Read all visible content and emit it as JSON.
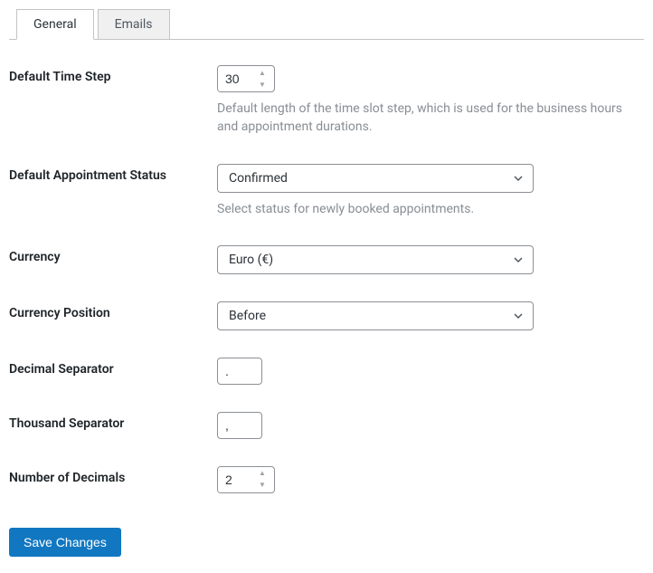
{
  "tabs": {
    "general": "General",
    "emails": "Emails"
  },
  "fields": {
    "default_time_step": {
      "label": "Default Time Step",
      "value": "30",
      "desc": "Default length of the time slot step, which is used for the business hours and appointment durations."
    },
    "default_status": {
      "label": "Default Appointment Status",
      "value": "Confirmed",
      "desc": "Select status for newly booked appointments."
    },
    "currency": {
      "label": "Currency",
      "value": "Euro (€)"
    },
    "currency_position": {
      "label": "Currency Position",
      "value": "Before"
    },
    "decimal_sep": {
      "label": "Decimal Separator",
      "value": "."
    },
    "thousand_sep": {
      "label": "Thousand Separator",
      "value": ","
    },
    "num_decimals": {
      "label": "Number of Decimals",
      "value": "2"
    }
  },
  "buttons": {
    "save": "Save Changes"
  }
}
